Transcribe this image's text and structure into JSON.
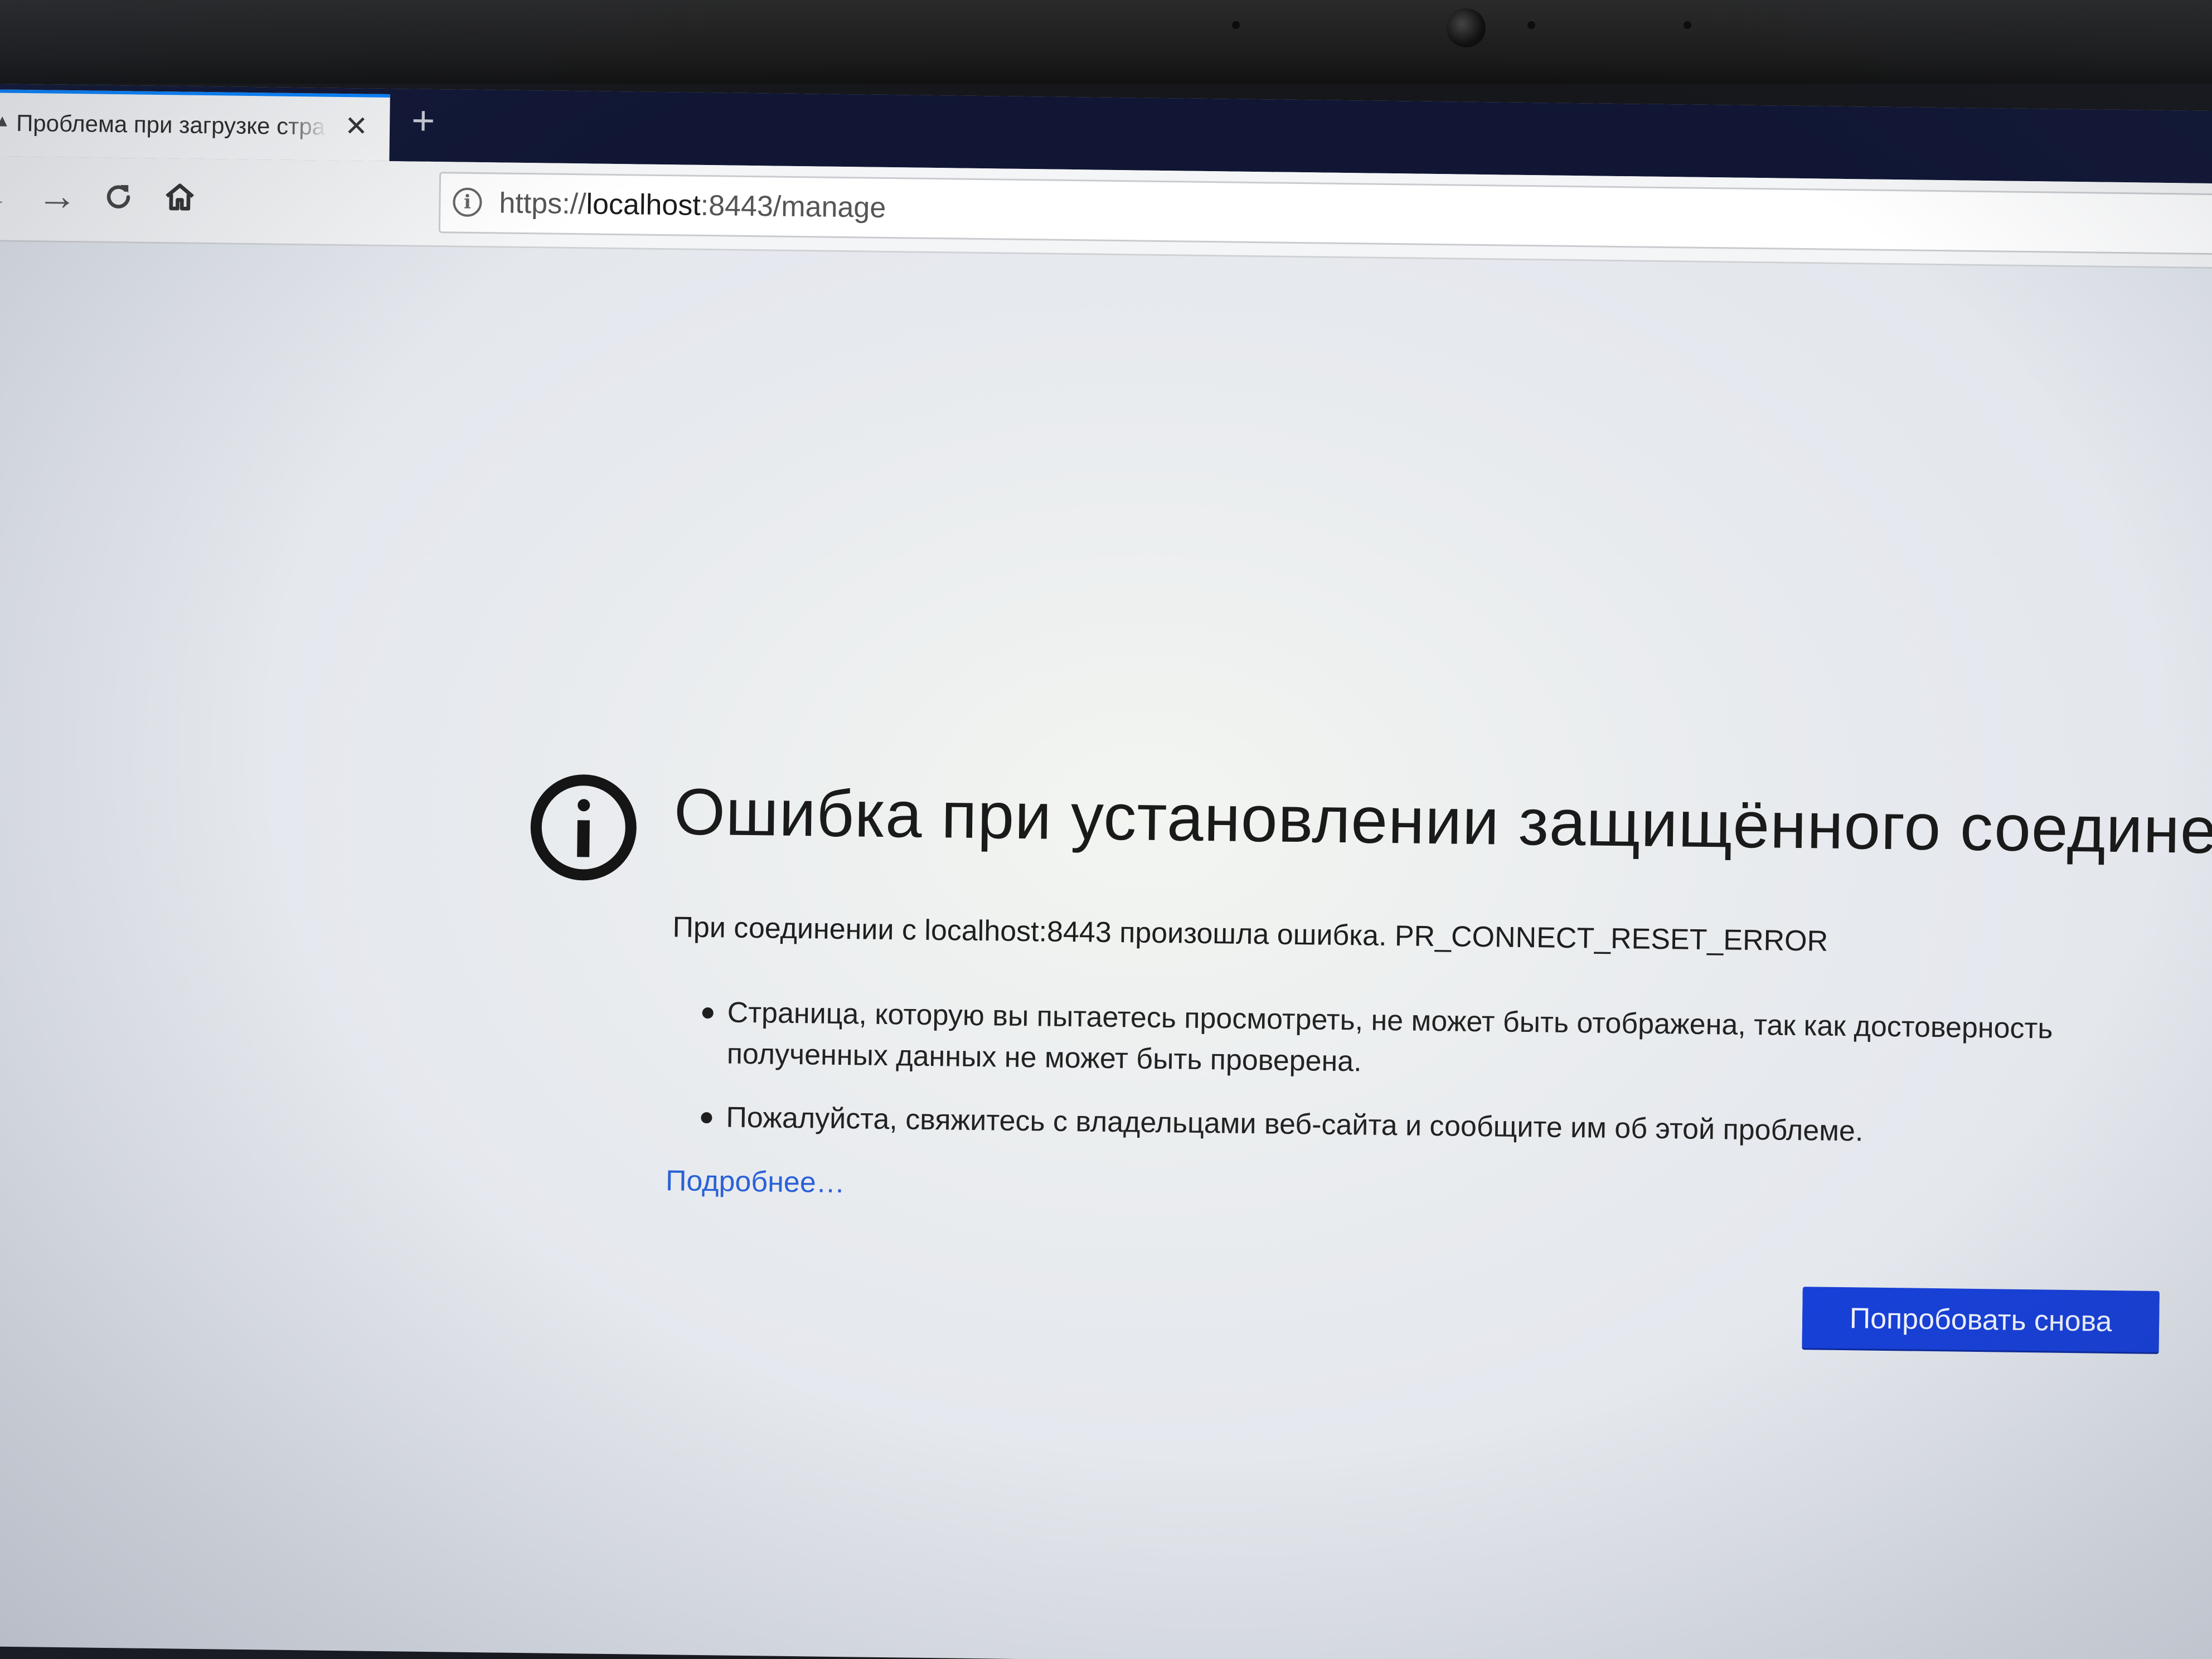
{
  "colors": {
    "tabstrip": "#101634",
    "accent": "#0a84ff",
    "link": "#2a61d6",
    "button": "#1740d8"
  },
  "tab": {
    "title": "Проблема при загрузке стра",
    "close_icon": "close-icon",
    "new_tab_icon": "plus-icon"
  },
  "toolbar": {
    "back_icon": "arrow-left-icon",
    "forward_icon": "arrow-right-icon",
    "reload_icon": "reload-icon",
    "home_icon": "home-icon"
  },
  "urlbar": {
    "info_icon": "info-icon",
    "scheme": "https://",
    "host": "localhost",
    "rest": ":8443/manage"
  },
  "error": {
    "icon": "info-circle-icon",
    "title": "Ошибка при установлении защищённого соединения",
    "description": "При соединении с localhost:8443 произошла ошибка. PR_CONNECT_RESET_ERROR",
    "bullets": [
      "Страница, которую вы пытаетесь просмотреть, не может быть отображена, так как достоверность полученных данных не может быть проверена.",
      "Пожалуйста, свяжитесь с владельцами веб-сайта и сообщите им об этой проблеме."
    ],
    "more_link": "Подробнее…",
    "retry_button": "Попробовать снова"
  }
}
